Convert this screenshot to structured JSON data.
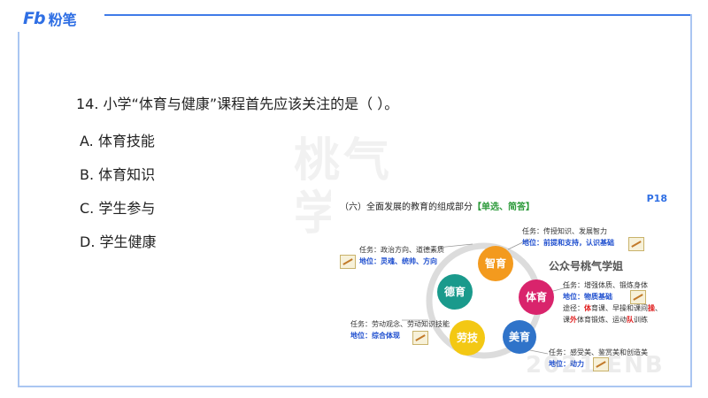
{
  "brand": {
    "mark": "Fb",
    "name": "粉笔"
  },
  "watermark": "桃气学姐",
  "question": {
    "text": "14. 小学“体育与健康”课程首先应该关注的是（ ）。",
    "options": [
      {
        "label": "A. 体育技能"
      },
      {
        "label": "B. 体育知识"
      },
      {
        "label": "C. 学生参与"
      },
      {
        "label": "D. 学生健康"
      }
    ]
  },
  "edu_image": {
    "title": "（六）全面发展的教育的组成部分",
    "tag": "【单选、简答】",
    "page": "P18",
    "gzh": "公众号桃气学姐",
    "bubbles": {
      "zhi": "智育",
      "de": "德育",
      "ti": "体育",
      "mei": "美育",
      "lao": "劳技"
    },
    "notes": {
      "zhi_task": "任务：传授知识、发展智力",
      "zhi_pos": "地位：前提和支持，认识基础",
      "de_task": "任务：政治方向、道德素质",
      "de_pos": "地位：灵魂、统帅、方向",
      "ti_task": "任务：增强体质、锻炼身体",
      "ti_pos": "地位：物质基础",
      "ti_way1": "途径：",
      "ti_way_red": "体",
      "ti_way2": "育课、早操和课间",
      "ti_way_red2": "操",
      "ti_way3": "、",
      "ti_way4": "课",
      "ti_way_red3": "外",
      "ti_way5": "体育锻炼、运动",
      "ti_way_red4": "队",
      "ti_way6": "训练",
      "lao_task": "任务：劳动观念、劳动知识技能",
      "lao_pos": "地位：综合体现",
      "mei_task": "任务：感受美、鉴赏美和创造美",
      "mei_pos": "地位：动力"
    },
    "corner_wm": "2021 ENB",
    "colors": {
      "zhi": "#f39a1e",
      "de": "#1a9a8c",
      "ti": "#d9246c",
      "mei": "#2f73c9",
      "lao": "#f3c814"
    }
  }
}
